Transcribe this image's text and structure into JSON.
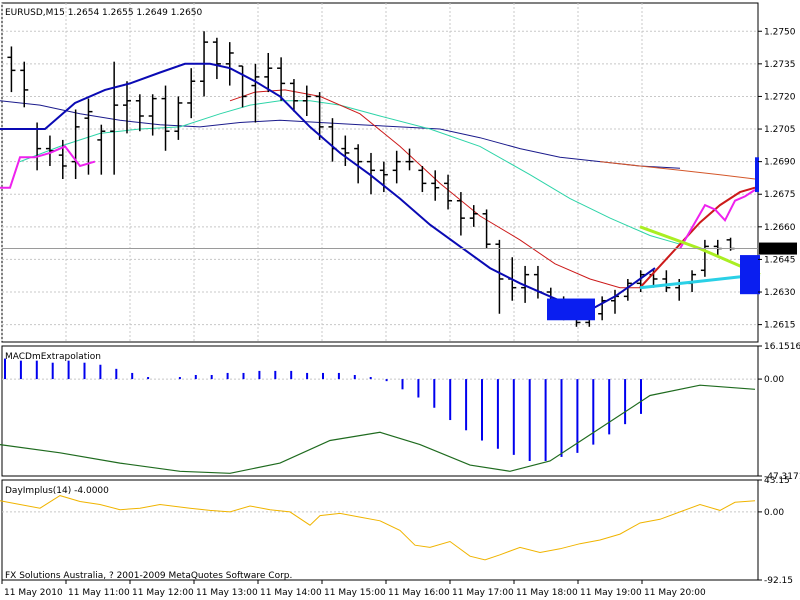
{
  "main": {
    "title": "EURUSD,M15  1.2654 1.2655 1.2649 1.2650",
    "price_tag": "1.2650",
    "ylim": [
      1.2607,
      1.2763
    ],
    "y_ticks": [
      "1.2750",
      "1.2735",
      "1.2720",
      "1.2705",
      "1.2690",
      "1.2675",
      "1.2660",
      "1.2645",
      "1.2630",
      "1.2615"
    ],
    "colors": {
      "ma_blue": "#0a0ab4",
      "ma_red": "#cc1a1a",
      "ma_aqua": "#2dd4a8",
      "ma_navy": "#1b1b8c",
      "ma_orange": "#d4572a",
      "magenta": "#ee22ee",
      "lime": "#aaee22",
      "cyan": "#2ad0e6",
      "box": "#0a1ef0"
    }
  },
  "macd": {
    "title": "MACDmExtrapolation",
    "y_ticks": [
      "16.1516",
      "0.00",
      "-47.3171"
    ],
    "ylim": [
      -47.3171,
      16.1516
    ]
  },
  "dayimp": {
    "title": "DayImplus(14) -4.0000",
    "y_ticks": [
      "43.15",
      "0.00",
      "-92.15"
    ],
    "ylim": [
      -92.15,
      43.15
    ]
  },
  "copyright": "FX Solutions Australia, ? 2001-2009 MetaQuotes Software Corp.",
  "x_ticks": [
    "11 May 2010",
    "11 May 11:00",
    "11 May 12:00",
    "11 May 13:00",
    "11 May 14:00",
    "11 May 15:00",
    "11 May 16:00",
    "11 May 17:00",
    "11 May 18:00",
    "11 May 19:00",
    "11 May 20:00"
  ],
  "chart_data": {
    "type": "line",
    "ohlc_bars": [
      [
        1.2738,
        1.2743,
        1.2722,
        1.2732
      ],
      [
        1.2732,
        1.2736,
        1.2715,
        1.2723
      ],
      [
        1.2705,
        1.2708,
        1.2686,
        1.2696
      ],
      [
        1.2696,
        1.2702,
        1.2688,
        1.2695
      ],
      [
        1.2693,
        1.27,
        1.2682,
        1.2688
      ],
      [
        1.269,
        1.2714,
        1.2682,
        1.2706
      ],
      [
        1.271,
        1.2719,
        1.2684,
        1.2713
      ],
      [
        1.27,
        1.2707,
        1.2684,
        1.2704
      ],
      [
        1.2704,
        1.2736,
        1.2684,
        1.2716
      ],
      [
        1.2716,
        1.2727,
        1.2703,
        1.2718
      ],
      [
        1.2718,
        1.2721,
        1.2704,
        1.2711
      ],
      [
        1.2711,
        1.2721,
        1.2702,
        1.2719
      ],
      [
        1.2719,
        1.2725,
        1.2695,
        1.2704
      ],
      [
        1.2704,
        1.272,
        1.27,
        1.2717
      ],
      [
        1.2717,
        1.2733,
        1.271,
        1.2727
      ],
      [
        1.2727,
        1.275,
        1.272,
        1.2745
      ],
      [
        1.2745,
        1.2747,
        1.2728,
        1.2735
      ],
      [
        1.2735,
        1.2745,
        1.2725,
        1.274
      ],
      [
        1.2734,
        1.2734,
        1.2715,
        1.272
      ],
      [
        1.2725,
        1.2735,
        1.2708,
        1.2729
      ],
      [
        1.2729,
        1.274,
        1.2722,
        1.2733
      ],
      [
        1.2733,
        1.2738,
        1.2718,
        1.2726
      ],
      [
        1.2726,
        1.2728,
        1.2713,
        1.2718
      ],
      [
        1.2718,
        1.2725,
        1.2711,
        1.272
      ],
      [
        1.272,
        1.2722,
        1.27,
        1.2706
      ],
      [
        1.2706,
        1.271,
        1.269,
        1.2696
      ],
      [
        1.2696,
        1.2702,
        1.2688,
        1.2694
      ],
      [
        1.2696,
        1.2698,
        1.268,
        1.269
      ],
      [
        1.269,
        1.2694,
        1.2675,
        1.2686
      ],
      [
        1.2686,
        1.269,
        1.2676,
        1.2684
      ],
      [
        1.2686,
        1.2695,
        1.268,
        1.269
      ],
      [
        1.269,
        1.2696,
        1.2686,
        1.269
      ],
      [
        1.2686,
        1.2688,
        1.2676,
        1.268
      ],
      [
        1.268,
        1.2686,
        1.2672,
        1.2678
      ],
      [
        1.268,
        1.2684,
        1.2668,
        1.2672
      ],
      [
        1.2672,
        1.2676,
        1.2656,
        1.2664
      ],
      [
        1.2664,
        1.267,
        1.266,
        1.2666
      ],
      [
        1.2666,
        1.2668,
        1.265,
        1.2652
      ],
      [
        1.2652,
        1.2654,
        1.262,
        1.2636
      ],
      [
        1.2636,
        1.2646,
        1.2626,
        1.2632
      ],
      [
        1.2632,
        1.2642,
        1.2625,
        1.2638
      ],
      [
        1.2638,
        1.2642,
        1.2627,
        1.263
      ],
      [
        1.263,
        1.2632,
        1.262,
        1.2626
      ],
      [
        1.2626,
        1.2628,
        1.2617,
        1.2618
      ],
      [
        1.2618,
        1.2622,
        1.2614,
        1.2616
      ],
      [
        1.2616,
        1.2624,
        1.2614,
        1.262
      ],
      [
        1.262,
        1.2628,
        1.2617,
        1.2626
      ],
      [
        1.2626,
        1.2631,
        1.262,
        1.2628
      ],
      [
        1.2628,
        1.2636,
        1.2626,
        1.2634
      ],
      [
        1.2634,
        1.264,
        1.263,
        1.2638
      ],
      [
        1.2638,
        1.264,
        1.2632,
        1.2636
      ],
      [
        1.2636,
        1.264,
        1.263,
        1.2632
      ],
      [
        1.2632,
        1.2636,
        1.2626,
        1.2634
      ],
      [
        1.2634,
        1.264,
        1.263,
        1.2638
      ],
      [
        1.264,
        1.2654,
        1.2637,
        1.2651
      ],
      [
        1.2651,
        1.2654,
        1.2646,
        1.265
      ],
      [
        1.2654,
        1.2655,
        1.2649,
        1.265
      ]
    ],
    "ma_blue": [
      [
        0,
        1.2705
      ],
      [
        45,
        1.2705
      ],
      [
        75,
        1.2717
      ],
      [
        105,
        1.2723
      ],
      [
        130,
        1.2726
      ],
      [
        160,
        1.2731
      ],
      [
        185,
        1.2735
      ],
      [
        210,
        1.2735
      ],
      [
        230,
        1.2733
      ],
      [
        255,
        1.2727
      ],
      [
        280,
        1.272
      ],
      [
        310,
        1.2706
      ],
      [
        340,
        1.2694
      ],
      [
        370,
        1.2684
      ],
      [
        400,
        1.2673
      ],
      [
        430,
        1.2661
      ],
      [
        460,
        1.2651
      ],
      [
        490,
        1.2641
      ],
      [
        520,
        1.2634
      ],
      [
        550,
        1.2628
      ],
      [
        575,
        1.2623
      ],
      [
        595,
        1.2623
      ],
      [
        615,
        1.2628
      ],
      [
        640,
        1.2636
      ],
      [
        655,
        1.2641
      ]
    ],
    "ma_red": [
      [
        640,
        1.2632
      ],
      [
        660,
        1.2642
      ],
      [
        680,
        1.2652
      ],
      [
        700,
        1.2662
      ],
      [
        720,
        1.267
      ],
      [
        740,
        1.2676
      ],
      [
        755,
        1.2678
      ]
    ],
    "ma_red_thin": [
      [
        230,
        1.2718
      ],
      [
        255,
        1.2722
      ],
      [
        285,
        1.2723
      ],
      [
        320,
        1.272
      ],
      [
        360,
        1.2712
      ],
      [
        400,
        1.2697
      ],
      [
        440,
        1.268
      ],
      [
        480,
        1.2665
      ],
      [
        520,
        1.2654
      ],
      [
        555,
        1.2643
      ],
      [
        590,
        1.2636
      ],
      [
        620,
        1.2632
      ],
      [
        640,
        1.2632
      ]
    ],
    "ma_aqua": [
      [
        20,
        1.269
      ],
      [
        60,
        1.2697
      ],
      [
        100,
        1.2703
      ],
      [
        140,
        1.2705
      ],
      [
        180,
        1.2706
      ],
      [
        220,
        1.2712
      ],
      [
        250,
        1.2716
      ],
      [
        280,
        1.2718
      ],
      [
        310,
        1.2718
      ],
      [
        340,
        1.2716
      ],
      [
        380,
        1.2711
      ],
      [
        430,
        1.2705
      ],
      [
        480,
        1.2697
      ],
      [
        530,
        1.2684
      ],
      [
        570,
        1.2673
      ],
      [
        610,
        1.2664
      ],
      [
        650,
        1.2656
      ],
      [
        680,
        1.2652
      ]
    ],
    "ma_navy": [
      [
        0,
        1.2718
      ],
      [
        40,
        1.2716
      ],
      [
        80,
        1.2712
      ],
      [
        120,
        1.2709
      ],
      [
        160,
        1.2707
      ],
      [
        200,
        1.2706
      ],
      [
        240,
        1.2708
      ],
      [
        280,
        1.2709
      ],
      [
        320,
        1.2708
      ],
      [
        360,
        1.2707
      ],
      [
        400,
        1.2706
      ],
      [
        440,
        1.2705
      ],
      [
        480,
        1.2701
      ],
      [
        520,
        1.2696
      ],
      [
        560,
        1.2692
      ],
      [
        600,
        1.269
      ],
      [
        640,
        1.2688
      ],
      [
        680,
        1.2687
      ]
    ],
    "ma_orange": [
      [
        600,
        1.269
      ],
      [
        640,
        1.2688
      ],
      [
        680,
        1.2686
      ],
      [
        720,
        1.2684
      ],
      [
        755,
        1.2682
      ]
    ],
    "magenta_left": [
      [
        0,
        1.2678
      ],
      [
        10,
        1.2678
      ],
      [
        20,
        1.2692
      ],
      [
        35,
        1.2692
      ],
      [
        50,
        1.2694
      ],
      [
        65,
        1.2697
      ],
      [
        80,
        1.2688
      ],
      [
        95,
        1.269
      ]
    ],
    "magenta_right": [
      [
        680,
        1.265
      ],
      [
        695,
        1.2662
      ],
      [
        705,
        1.267
      ],
      [
        715,
        1.2668
      ],
      [
        725,
        1.2663
      ],
      [
        735,
        1.2672
      ],
      [
        745,
        1.2674
      ],
      [
        755,
        1.2677
      ]
    ],
    "lime_line": [
      [
        640,
        1.266
      ],
      [
        700,
        1.265
      ],
      [
        760,
        1.2638
      ]
    ],
    "cyan_line": [
      [
        640,
        1.2632
      ],
      [
        700,
        1.2635
      ],
      [
        760,
        1.2638
      ]
    ],
    "boxes": [
      [
        547,
        1.2617,
        1.2627,
        48
      ],
      [
        755,
        1.2676,
        1.2692,
        4
      ],
      [
        740,
        1.2629,
        1.2647,
        20
      ]
    ],
    "macd_hist": [
      10,
      9,
      9,
      8,
      9,
      8,
      7,
      5,
      3,
      1,
      0,
      1,
      2,
      2,
      3,
      3,
      4,
      4,
      4,
      3,
      3,
      3,
      2,
      1,
      -1,
      -5,
      -9,
      -14,
      -20,
      -25,
      -30,
      -34,
      -37,
      -40,
      -40,
      -38,
      -36,
      -32,
      -27,
      -22,
      -17
    ],
    "macd_signal": [
      [
        0,
        -32
      ],
      [
        60,
        -36
      ],
      [
        120,
        -41
      ],
      [
        180,
        -45
      ],
      [
        230,
        -46
      ],
      [
        280,
        -41
      ],
      [
        330,
        -30
      ],
      [
        380,
        -26
      ],
      [
        420,
        -32
      ],
      [
        470,
        -42
      ],
      [
        510,
        -45
      ],
      [
        550,
        -40
      ],
      [
        600,
        -24
      ],
      [
        650,
        -8
      ],
      [
        700,
        -3
      ],
      [
        755,
        -5
      ]
    ],
    "dayimp_line": [
      [
        0,
        15
      ],
      [
        20,
        10
      ],
      [
        40,
        5
      ],
      [
        60,
        22
      ],
      [
        80,
        14
      ],
      [
        100,
        10
      ],
      [
        120,
        3
      ],
      [
        140,
        5
      ],
      [
        160,
        10
      ],
      [
        190,
        5
      ],
      [
        210,
        2
      ],
      [
        230,
        0
      ],
      [
        250,
        8
      ],
      [
        270,
        3
      ],
      [
        290,
        0
      ],
      [
        310,
        -18
      ],
      [
        320,
        -5
      ],
      [
        340,
        -2
      ],
      [
        360,
        -7
      ],
      [
        380,
        -12
      ],
      [
        400,
        -25
      ],
      [
        415,
        -45
      ],
      [
        430,
        -48
      ],
      [
        450,
        -40
      ],
      [
        470,
        -60
      ],
      [
        485,
        -65
      ],
      [
        500,
        -58
      ],
      [
        520,
        -48
      ],
      [
        540,
        -55
      ],
      [
        560,
        -50
      ],
      [
        580,
        -43
      ],
      [
        600,
        -38
      ],
      [
        620,
        -30
      ],
      [
        640,
        -15
      ],
      [
        660,
        -10
      ],
      [
        680,
        0
      ],
      [
        700,
        10
      ],
      [
        720,
        2
      ],
      [
        735,
        13
      ],
      [
        755,
        15
      ]
    ]
  }
}
